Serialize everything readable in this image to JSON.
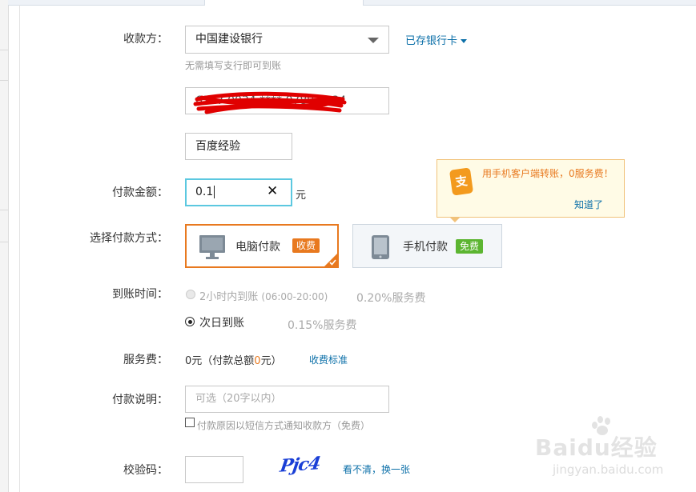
{
  "payee": {
    "label": "收款方：",
    "bank_selected": "中国建设银行",
    "saved_cards_link": "已存银行卡",
    "hint": "无需填写支行即可到账",
    "account_value": "6217 0034 **** 0789 1234",
    "name_value": "百度经验"
  },
  "amount": {
    "label": "付款金额：",
    "value": "0.1",
    "clear_glyph": "✕",
    "unit": "元"
  },
  "tooltip": {
    "icon_glyph": "支",
    "text": "用手机客户端转账，0服务费！",
    "dismiss": "知道了"
  },
  "method": {
    "label": "选择付款方式：",
    "pc": {
      "label": "电脑付款",
      "tag": "收费"
    },
    "mobile": {
      "label": "手机付款",
      "tag": "免费"
    }
  },
  "arrival": {
    "label": "到账时间：",
    "opt1": {
      "label": "2小时内到账",
      "sub": "(06:00-20:00)",
      "fee": "0.20%服务费"
    },
    "opt2": {
      "label": "次日到账",
      "fee": "0.15%服务费"
    }
  },
  "service_fee": {
    "label": "服务费：",
    "pre": "0元（付款总额",
    "amount": "0",
    "post": "元）",
    "link": "收费标准"
  },
  "note": {
    "label": "付款说明：",
    "placeholder": "可选（20字以内）",
    "checkbox_label": "付款原因以短信方式通知收款方（免费）"
  },
  "captcha": {
    "label": "校验码：",
    "image_text": "Pjc4",
    "refresh_link": "看不清，换一张"
  },
  "watermark": {
    "brand": "Baidu经验",
    "url": "jingyan.baidu.com"
  },
  "colors": {
    "accent_orange": "#e8791f",
    "green_tag": "#5cb531",
    "link_blue": "#0b6fa8",
    "focus_border": "#5cc8e0",
    "scribble_red": "#e00000"
  }
}
